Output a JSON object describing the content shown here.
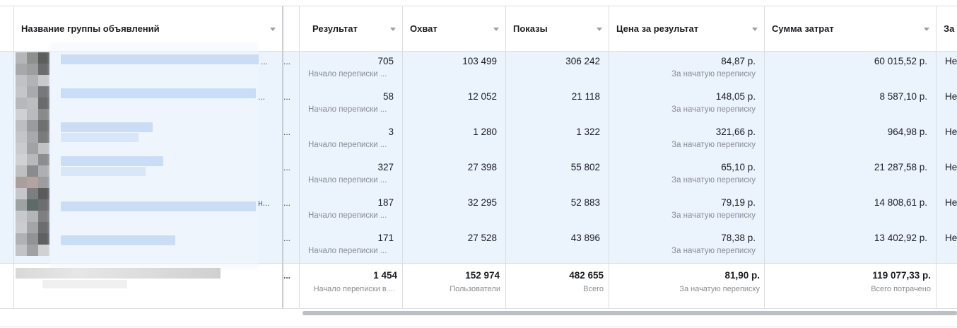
{
  "columns": {
    "name": "Название группы объявлений",
    "result": "Результат",
    "reach": "Охват",
    "impressions": "Показы",
    "cost_per_result": "Цена за результат",
    "amount_spent": "Сумма затрат",
    "last": "За"
  },
  "rows": [
    {
      "result": "705",
      "result_sub": "Начало переписки ...",
      "reach": "103 499",
      "impressions": "306 242",
      "cpr": "84,87 р.",
      "cpr_sub": "За начатую переписку",
      "spent": "60 015,52 р.",
      "last": "Не"
    },
    {
      "result": "58",
      "result_sub": "Начало переписки ...",
      "reach": "12 052",
      "impressions": "21 118",
      "cpr": "148,05 р.",
      "cpr_sub": "За начатую переписку",
      "spent": "8 587,10 р.",
      "last": "Не"
    },
    {
      "result": "3",
      "result_sub": "Начало переписки ...",
      "reach": "1 280",
      "impressions": "1 322",
      "cpr": "321,66 р.",
      "cpr_sub": "За начатую переписку",
      "spent": "964,98 р.",
      "last": "Не"
    },
    {
      "result": "327",
      "result_sub": "Начало переписки ...",
      "reach": "27 398",
      "impressions": "55 802",
      "cpr": "65,10 р.",
      "cpr_sub": "За начатую переписку",
      "spent": "21 287,58 р.",
      "last": "Не"
    },
    {
      "result": "187",
      "result_sub": "Начало переписки ...",
      "reach": "32 295",
      "impressions": "52 883",
      "cpr": "79,19 р.",
      "cpr_sub": "За начатую переписку",
      "spent": "14 808,61 р.",
      "last": "Не"
    },
    {
      "result": "171",
      "result_sub": "Начало переписки ...",
      "reach": "27 528",
      "impressions": "43 896",
      "cpr": "78,38 р.",
      "cpr_sub": "За начатую переписку",
      "spent": "13 402,92 р.",
      "last": "Не"
    }
  ],
  "totals": {
    "result": "1 454",
    "result_sub": "Начало переписки в ...",
    "reach": "152 974",
    "reach_sub": "Пользователи",
    "impressions": "482 655",
    "impressions_sub": "Всего",
    "cpr": "81,90 р.",
    "cpr_sub": "За начатую переписку",
    "spent": "119 077,33 р.",
    "spent_sub": "Всего потрачено"
  },
  "ellipsis": "...",
  "truncation_marks": [
    "...",
    "...",
    "н..."
  ],
  "colors": {
    "selected_band": "#ebf3fd",
    "border": "#dadde1",
    "subtext": "#8a8d91",
    "scrollbar": "#bcc0c4"
  }
}
